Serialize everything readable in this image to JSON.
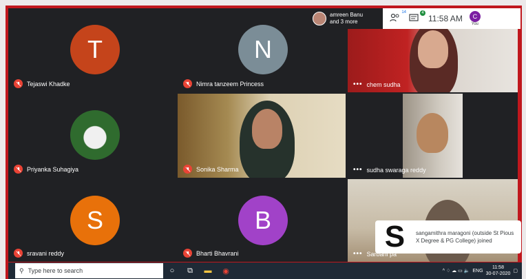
{
  "participants": [
    {
      "name": "Tejaswi Khadke",
      "initial": "T",
      "color": "#c5441b",
      "muted": true
    },
    {
      "name": "Nimra tanzeem Princess",
      "initial": "N",
      "color": "#7b8d97",
      "muted": true
    },
    {
      "name": "chem sudha",
      "muted": false
    },
    {
      "name": "Priyanka Suhagiya",
      "muted": true
    },
    {
      "name": "Sonika Sharma",
      "muted": true
    },
    {
      "name": "sudha swaraga reddy",
      "muted": false
    },
    {
      "name": "sravani reddy",
      "initial": "S",
      "color": "#e8710a",
      "muted": true
    },
    {
      "name": "Bharti Bhavrani",
      "initial": "B",
      "color": "#a142c8",
      "muted": true
    },
    {
      "name": "Sarbani pa",
      "muted": false
    }
  ],
  "presenter": {
    "line1": "amreen Banu",
    "line2": "and 3 more"
  },
  "status": {
    "people_count": "14",
    "chat_count": "4",
    "time": "11:58 AM",
    "you_initial": "C",
    "you_label": "You"
  },
  "toast": {
    "initial": "S",
    "message": "sangamithra maragoni (outside St Pious X Degree & PG College) joined"
  },
  "taskbar": {
    "search_placeholder": "Type here to search",
    "lang": "ENG",
    "time": "11:58",
    "date": "30-07-2020"
  }
}
